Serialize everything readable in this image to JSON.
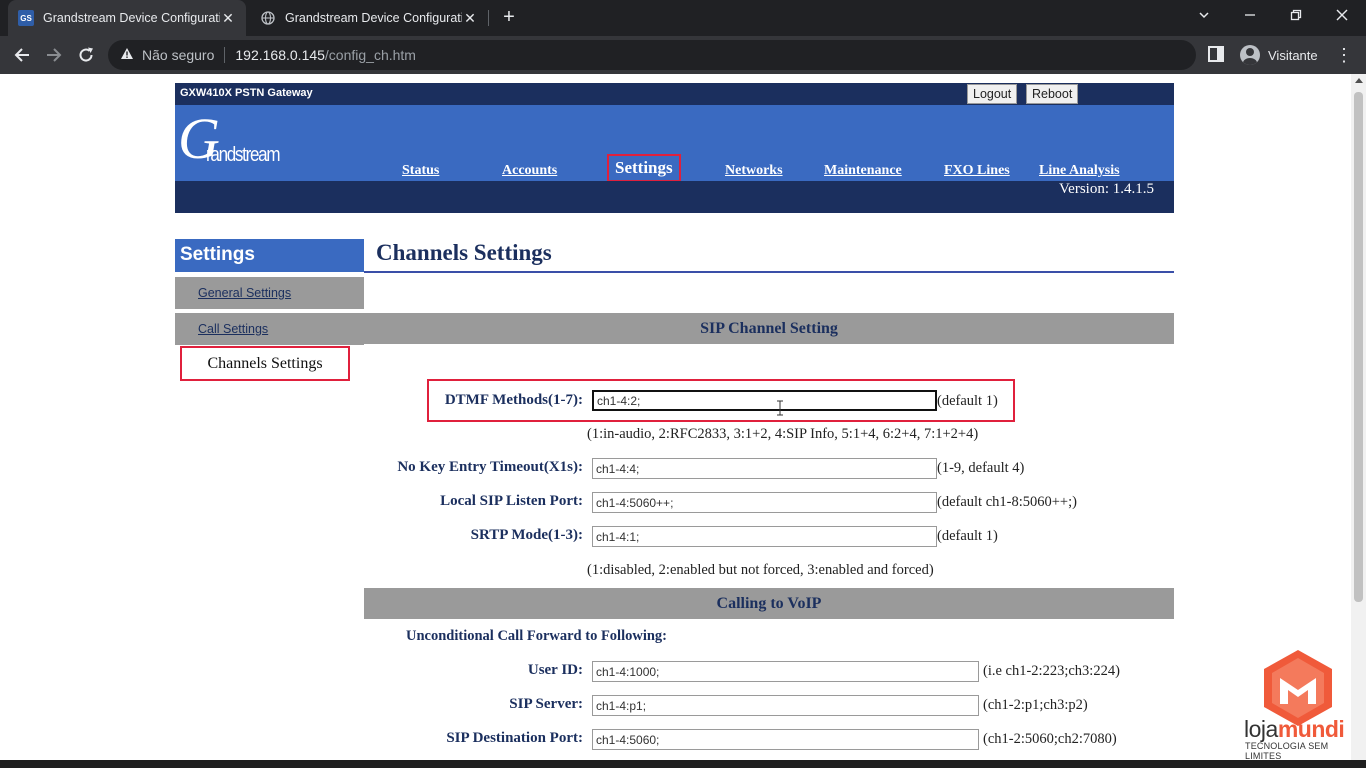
{
  "browser": {
    "tabs": [
      {
        "title": "Grandstream Device Configuration",
        "active": true,
        "favicon": "GS"
      },
      {
        "title": "Grandstream Device Configuration",
        "active": false,
        "favicon": "globe-icon"
      }
    ],
    "security_label": "Não seguro",
    "url_host": "192.168.0.145",
    "url_path": "/config_ch.htm",
    "profile_name": "Visitante"
  },
  "header": {
    "product": "GXW410X PSTN Gateway",
    "logout_label": "Logout",
    "reboot_label": "Reboot",
    "logo_letter": "G",
    "logo_word": "randstream",
    "version": "Version: 1.4.1.5",
    "nav": [
      "Status",
      "Accounts",
      "Settings",
      "Networks",
      "Maintenance",
      "FXO Lines",
      "Line Analysis"
    ],
    "active_nav": "Settings"
  },
  "sidebar": {
    "title": "Settings",
    "items": [
      "General Settings",
      "Call Settings",
      "Channels Settings"
    ],
    "active_item": "Channels Settings"
  },
  "main": {
    "title": "Channels Settings",
    "sip_section": "SIP Channel Setting",
    "fields": {
      "dtmf": {
        "label": "DTMF Methods(1-7):",
        "value": "ch1-4:2;",
        "hint": "(default 1)"
      },
      "dtmf_help": "(1:in-audio, 2:RFC2833, 3:1+2, 4:SIP Info, 5:1+4, 6:2+4, 7:1+2+4)",
      "no_key": {
        "label": "No Key Entry Timeout(X1s):",
        "value": "ch1-4:4;",
        "hint": "(1-9, default 4)"
      },
      "local_sip": {
        "label": "Local SIP Listen Port:",
        "value": "ch1-4:5060++;",
        "hint": "(default ch1-8:5060++;)"
      },
      "srtp": {
        "label": "SRTP Mode(1-3):",
        "value": "ch1-4:1;",
        "hint": "(default 1)"
      },
      "srtp_help": "(1:disabled, 2:enabled but not forced, 3:enabled and forced)"
    },
    "voip_section": "Calling to VoIP",
    "forward_heading": "Unconditional Call Forward to Following:",
    "forward": {
      "user_id": {
        "label": "User ID:",
        "value": "ch1-4:1000;",
        "hint": "(i.e ch1-2:223;ch3:224)"
      },
      "sip_server": {
        "label": "SIP Server:",
        "value": "ch1-4:p1;",
        "hint": "(ch1-2:p1;ch3:p2)"
      },
      "sip_dest_port": {
        "label": "SIP Destination Port:",
        "value": "ch1-4:5060;",
        "hint": "(ch1-2:5060;ch2:7080)"
      }
    }
  },
  "watermark": {
    "brand_part1": "loja",
    "brand_part2": "mundi",
    "tagline": "TECNOLOGIA SEM LIMITES",
    "accent_color": "#f05a3a"
  },
  "colors": {
    "nav_blue": "#3a6ac1",
    "dark_navy": "#1b2f5e",
    "section_gray": "#9a9a9a",
    "highlight_red": "#e0203c"
  }
}
